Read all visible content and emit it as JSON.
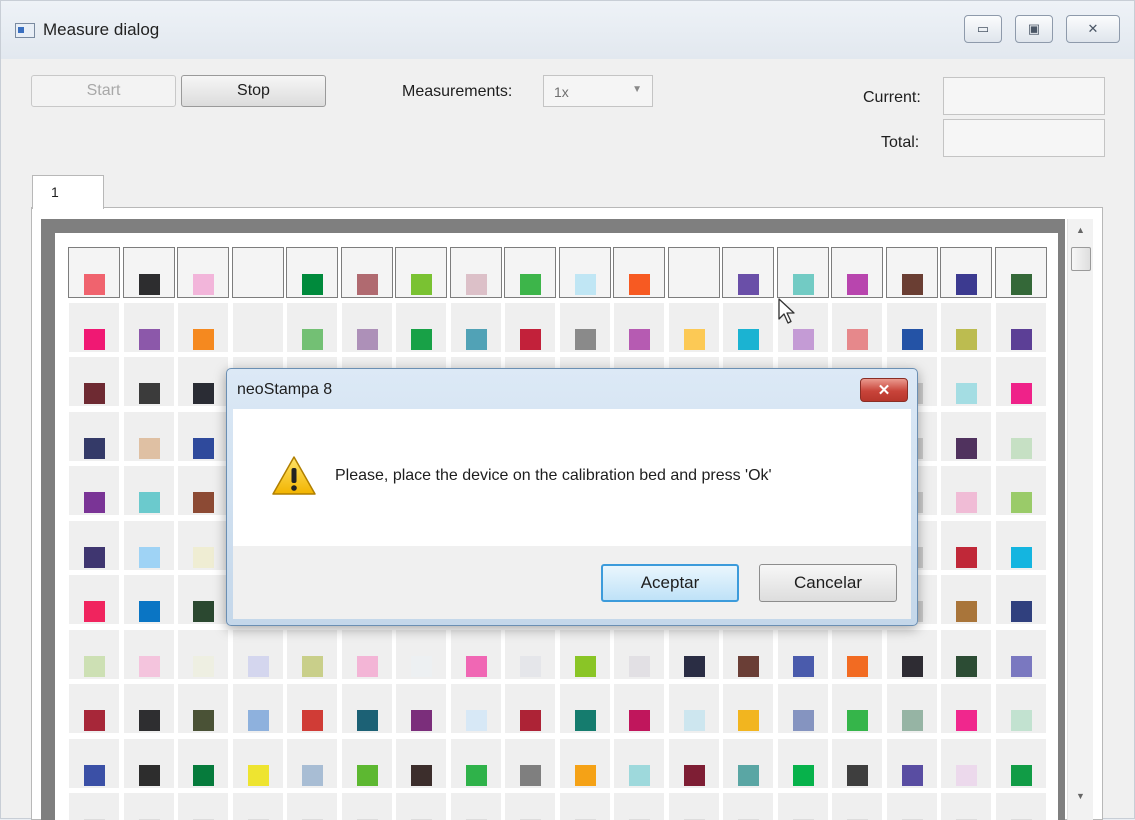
{
  "window": {
    "title": "Measure dialog",
    "controls": {
      "minimize": "▭",
      "maximize": "▣",
      "close": "✕"
    }
  },
  "toolbar": {
    "start_label": "Start",
    "stop_label": "Stop",
    "measurements_label": "Measurements:",
    "measurements_value": "1x",
    "current_label": "Current:",
    "current_value": "",
    "total_label": "Total:",
    "total_value": ""
  },
  "tabs": [
    {
      "label": "1"
    }
  ],
  "patch_grid": {
    "columns": 18,
    "rows": [
      [
        "#f0636e",
        "#2d2d2f",
        "#f2b5da",
        null,
        "#008a3c",
        "#b06a70",
        "#7ac232",
        "#dcc0c8",
        "#3db54a",
        "#c0e6f4",
        "#f75a22",
        null,
        "#6a4fa8",
        "#72cbc4",
        "#b845ae",
        "#6a3e33",
        "#3c3a90",
        "#346838"
      ],
      [
        "#f01873",
        "#8c58aa",
        "#f5891f",
        null,
        "#73c074",
        "#ad90b8",
        "#18a147",
        "#51a2b6",
        "#c2213a",
        "#8a8a8a",
        "#b65bb2",
        "#fcc955",
        "#1bb3d2",
        "#c49bd5",
        "#e6888b",
        "#2453a6",
        "#bcbc50",
        "#5c3f96"
      ],
      [
        "#6e2a32",
        "#3b3b3b",
        "#2a2c34",
        "#cccccc",
        "#cccccc",
        "#cccccc",
        "#cccccc",
        "#cccccc",
        "#cccccc",
        "#cccccc",
        "#cccccc",
        "#cccccc",
        "#cccccc",
        "#cccccc",
        "#cccccc",
        "#cccccc",
        "#a4dde3",
        "#ef2289"
      ],
      [
        "#343a68",
        "#dfc0a3",
        "#2f4a9c",
        "#cccccc",
        "#cccccc",
        "#cccccc",
        "#cccccc",
        "#cccccc",
        "#cccccc",
        "#cccccc",
        "#cccccc",
        "#cccccc",
        "#cccccc",
        "#cccccc",
        "#cccccc",
        "#cccccc",
        "#50325e",
        "#c6e0c4"
      ],
      [
        "#7a3496",
        "#6bcacd",
        "#8c4a34",
        "#cccccc",
        "#cccccc",
        "#cccccc",
        "#cccccc",
        "#cccccc",
        "#cccccc",
        "#cccccc",
        "#cccccc",
        "#cccccc",
        "#cccccc",
        "#cccccc",
        "#cccccc",
        "#cccccc",
        "#f0bcd6",
        "#9acb69"
      ],
      [
        "#3f3670",
        "#9fd3f5",
        "#efedd3",
        "#cccccc",
        "#cccccc",
        "#cccccc",
        "#cccccc",
        "#cccccc",
        "#cccccc",
        "#cccccc",
        "#cccccc",
        "#cccccc",
        "#cccccc",
        "#cccccc",
        "#cccccc",
        "#cccccc",
        "#c02838",
        "#14b5e0"
      ],
      [
        "#f0245e",
        "#0a75c4",
        "#2b4830",
        "#cccccc",
        "#cccccc",
        "#cccccc",
        "#cccccc",
        "#cccccc",
        "#cccccc",
        "#cccccc",
        "#cccccc",
        "#cccccc",
        "#cccccc",
        "#cccccc",
        "#cccccc",
        "#cccccc",
        "#a9753a",
        "#30407e"
      ],
      [
        "#cde0b4",
        "#f4c4dd",
        "#eeefe2",
        "#d4d6ee",
        "#c9cf8a",
        "#f3b5d6",
        "#edf0f2",
        "#f067b4",
        "#e5e6ea",
        "#8ac526",
        "#e2e0e4",
        "#2a2d44",
        "#6a3e36",
        "#4a5bac",
        "#f26b22",
        "#2e2c33",
        "#2c4c34",
        "#7a78c0"
      ],
      [
        "#a72739",
        "#2e2e30",
        "#4a5236",
        "#8eb1dd",
        "#d03c36",
        "#1c6175",
        "#7b2e7b",
        "#d7e8f6",
        "#ad2336",
        "#157c6e",
        "#c0165c",
        "#cde6ef",
        "#f2b51f",
        "#8594c0",
        "#35b54a",
        "#96b4a4",
        "#f0278d",
        "#c2e2d0"
      ],
      [
        "#3b50a6",
        "#2d2d2d",
        "#067b3c",
        "#eee430",
        "#a8bdd4",
        "#5db831",
        "#3c2e2c",
        "#2fb24a",
        "#7f7f7f",
        "#f5a216",
        "#9ed9dc",
        "#7e1e34",
        "#5aa6a4",
        "#07b24b",
        "#3e3e3e",
        "#594da2",
        "#ecd9ec",
        "#119c46"
      ],
      [
        "#dddddd",
        "#dddddd",
        "#dddddd",
        "#dddddd",
        "#dddddd",
        "#dddddd",
        "#dddddd",
        "#dddddd",
        "#dddddd",
        "#dddddd",
        "#dddddd",
        "#dddddd",
        "#dddddd",
        "#dddddd",
        "#dddddd",
        "#dddddd",
        "#dddddd",
        "#dddddd"
      ]
    ]
  },
  "message_box": {
    "title": "neoStampa 8",
    "close": "✕",
    "message": "Please, place the device on the calibration bed and press 'Ok'",
    "icon": "warning-icon",
    "ok_label": "Aceptar",
    "cancel_label": "Cancelar"
  }
}
